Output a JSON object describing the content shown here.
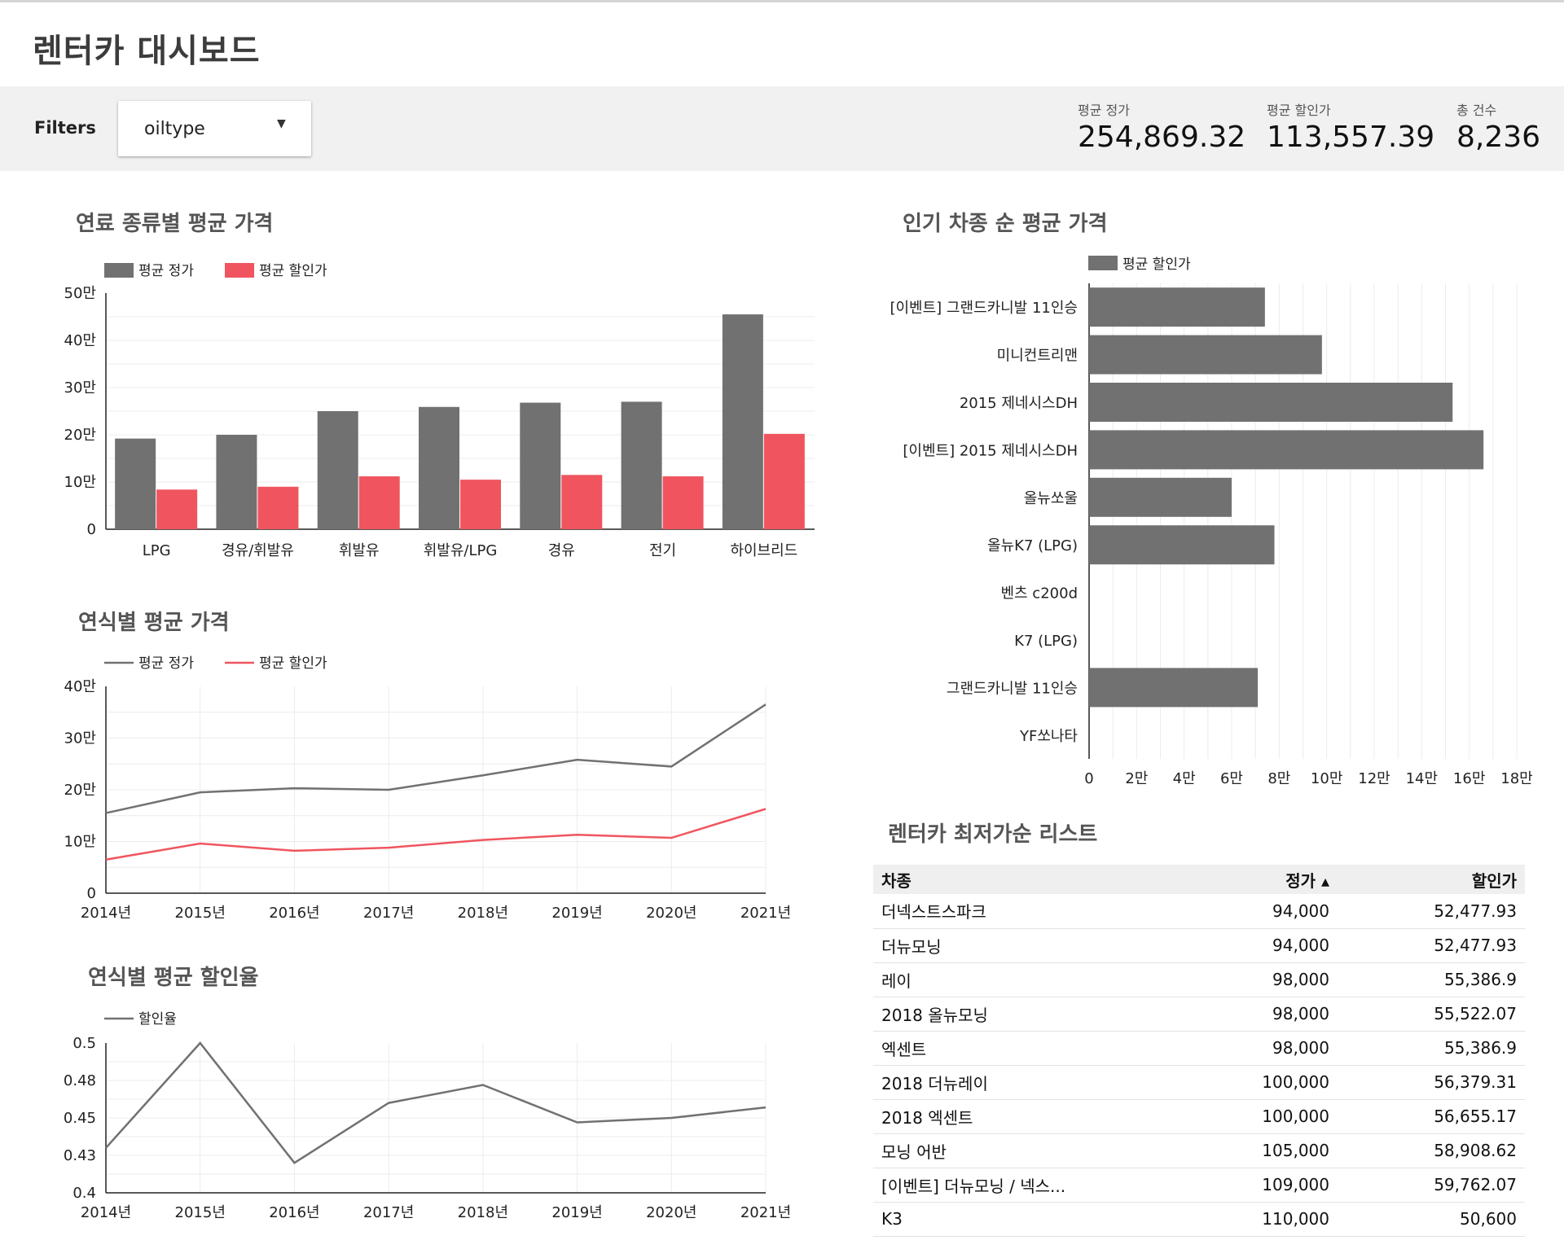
{
  "page": {
    "title": "렌터카 대시보드"
  },
  "filters": {
    "label": "Filters",
    "dropdown_value": "oiltype",
    "dropdown_icon": "caret-down-icon"
  },
  "scorecards": [
    {
      "label": "평균 정가",
      "value": "254,869.32"
    },
    {
      "label": "평균 할인가",
      "value": "113,557.39"
    },
    {
      "label": "총 건수",
      "value": "8,236"
    }
  ],
  "colors": {
    "primary": "#717171",
    "accent": "#f0555f",
    "header_bg": "#f1f1f1"
  },
  "chart_data": [
    {
      "id": "fuel",
      "type": "bar",
      "title": "연료 종류별 평균 가격",
      "categories": [
        "LPG",
        "경유/휘발유",
        "휘발유",
        "휘발유/LPG",
        "경유",
        "전기",
        "하이브리드"
      ],
      "series": [
        {
          "name": "평균 정가",
          "color": "#717171",
          "values": [
            192000,
            200000,
            250000,
            259000,
            268000,
            270000,
            455000
          ]
        },
        {
          "name": "평균 할인가",
          "color": "#f0555f",
          "values": [
            84000,
            90000,
            112000,
            105000,
            115000,
            112000,
            202000
          ]
        }
      ],
      "yticks": [
        "0",
        "10만",
        "20만",
        "30만",
        "40만",
        "50만"
      ],
      "ylim": [
        0,
        500000
      ],
      "grid": true,
      "legend": "top-left"
    },
    {
      "id": "year_price",
      "type": "line",
      "title": "연식별 평균 가격",
      "x": [
        "2014년",
        "2015년",
        "2016년",
        "2017년",
        "2018년",
        "2019년",
        "2020년",
        "2021년"
      ],
      "series": [
        {
          "name": "평균 정가",
          "color": "#717171",
          "values": [
            155000,
            195000,
            203000,
            200000,
            228000,
            258000,
            245000,
            365000
          ]
        },
        {
          "name": "평균 할인가",
          "color": "#f0555f",
          "values": [
            65000,
            96000,
            82000,
            88000,
            103000,
            113000,
            107000,
            163000
          ]
        }
      ],
      "yticks": [
        "0",
        "10만",
        "20만",
        "30만",
        "40만"
      ],
      "ylim": [
        0,
        400000
      ],
      "grid": true,
      "legend": "top-left"
    },
    {
      "id": "year_discount",
      "type": "line",
      "title": "연식별 평균 할인율",
      "x": [
        "2014년",
        "2015년",
        "2016년",
        "2017년",
        "2018년",
        "2019년",
        "2020년",
        "2021년"
      ],
      "series": [
        {
          "name": "할인율",
          "color": "#717171",
          "values": [
            0.43,
            0.5,
            0.42,
            0.46,
            0.472,
            0.447,
            0.45,
            0.457
          ]
        }
      ],
      "yticks": [
        "0.4",
        "0.43",
        "0.45",
        "0.48",
        "0.5"
      ],
      "ylim": [
        0.4,
        0.5
      ],
      "grid": true,
      "legend": "top-left"
    },
    {
      "id": "popular",
      "type": "bar",
      "orientation": "horizontal",
      "title": "인기 차종 순 평균 가격",
      "categories": [
        "[이벤트] 그랜드카니발 11인승",
        "미니컨트리맨",
        "2015 제네시스DH",
        "[이벤트] 2015 제네시스DH",
        "올뉴쏘울",
        "올뉴K7 (LPG)",
        "벤츠 c200d",
        "K7 (LPG)",
        "그랜드카니발 11인승",
        "YF쏘나타"
      ],
      "series": [
        {
          "name": "평균 할인가",
          "color": "#717171",
          "values": [
            74000,
            98000,
            153000,
            166000,
            60000,
            78000,
            0,
            0,
            71000,
            0
          ]
        }
      ],
      "xticks": [
        "0",
        "2만",
        "4만",
        "6만",
        "8만",
        "10만",
        "12만",
        "14만",
        "16만",
        "18만"
      ],
      "xlim": [
        0,
        180000
      ],
      "grid": true,
      "legend": "top-left"
    }
  ],
  "table": {
    "title": "렌터카 최저가순 리스트",
    "columns": [
      "차종",
      "정가 ▴",
      "할인가"
    ],
    "rows": [
      [
        "더넥스트스파크",
        "94,000",
        "52,477.93"
      ],
      [
        "더뉴모닝",
        "94,000",
        "52,477.93"
      ],
      [
        "레이",
        "98,000",
        "55,386.9"
      ],
      [
        "2018 올뉴모닝",
        "98,000",
        "55,522.07"
      ],
      [
        "엑센트",
        "98,000",
        "55,386.9"
      ],
      [
        "2018 더뉴레이",
        "100,000",
        "56,379.31"
      ],
      [
        "2018 엑센트",
        "100,000",
        "56,655.17"
      ],
      [
        "모닝 어반",
        "105,000",
        "58,908.62"
      ],
      [
        "[이벤트] 더뉴모닝 / 넥스...",
        "109,000",
        "59,762.07"
      ],
      [
        "K3",
        "110,000",
        "50,600"
      ]
    ]
  }
}
